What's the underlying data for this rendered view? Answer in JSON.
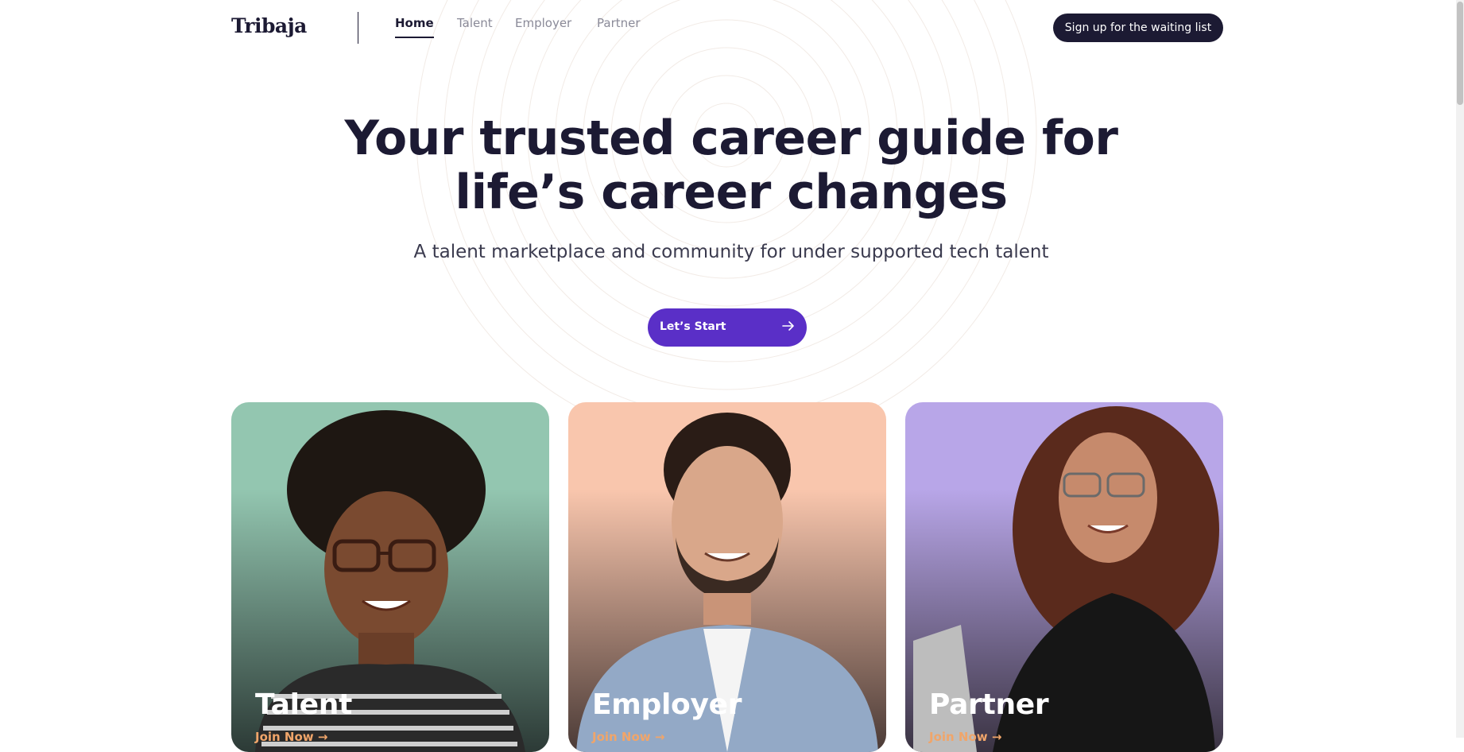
{
  "brand": {
    "logo": "Tribaja"
  },
  "nav": {
    "items": [
      {
        "label": "Home",
        "active": true
      },
      {
        "label": "Talent",
        "active": false
      },
      {
        "label": "Employer",
        "active": false
      },
      {
        "label": "Partner",
        "active": false
      }
    ]
  },
  "header": {
    "signup_label": "Sign up for the waiting list"
  },
  "hero": {
    "title": "Your trusted career guide for life’s career changes",
    "subtitle": "A talent marketplace and community for under supported tech talent",
    "cta_label": "Let’s Start",
    "cta_icon": "arrow-right-icon"
  },
  "cards": [
    {
      "title": "Talent",
      "link": "Join Now →",
      "color": "#93c6b0"
    },
    {
      "title": "Employer",
      "link": "Join Now →",
      "color": "#f9c6ad"
    },
    {
      "title": "Partner",
      "link": "Join Now →",
      "color": "#b8a6e8"
    }
  ],
  "colors": {
    "primary": "#1c1a33",
    "accent": "#5a2fc7",
    "link": "#f0a56a"
  }
}
